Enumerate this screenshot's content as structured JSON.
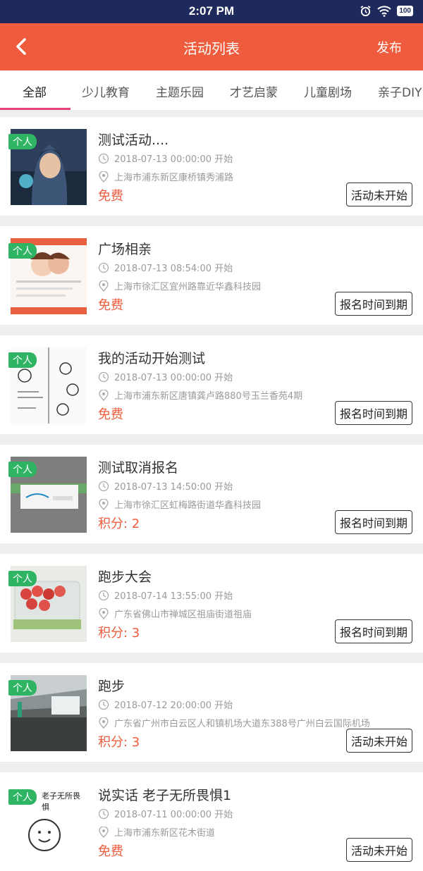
{
  "status_bar": {
    "time": "2:07 PM",
    "battery": "100"
  },
  "header": {
    "title": "活动列表",
    "publish_label": "发布"
  },
  "tabs": [
    {
      "label": "全部"
    },
    {
      "label": "少儿教育"
    },
    {
      "label": "主题乐园"
    },
    {
      "label": "才艺启蒙"
    },
    {
      "label": "儿童剧场"
    },
    {
      "label": "亲子DIY"
    }
  ],
  "activities": [
    {
      "badge": "个人",
      "title": "测试活动....",
      "time": "2018-07-13 00:00:00 开始",
      "location": "上海市浦东新区康桥镇秀浦路",
      "price": "免费",
      "status": "活动未开始"
    },
    {
      "badge": "个人",
      "title": "广场相亲",
      "time": "2018-07-13 08:54:00 开始",
      "location": "上海市徐汇区宜州路靠近华鑫科技园",
      "price": "免费",
      "status": "报名时间到期"
    },
    {
      "badge": "个人",
      "title": "我的活动开始测试",
      "time": "2018-07-13 00:00:00 开始",
      "location": "上海市浦东新区唐镇龚卢路880号玉兰香苑4期",
      "price": "免费",
      "status": "报名时间到期"
    },
    {
      "badge": "个人",
      "title": "测试取消报名",
      "time": "2018-07-13 14:50:00 开始",
      "location": "上海市徐汇区虹梅路街道华鑫科技园",
      "price": "积分: 2",
      "status": "报名时间到期"
    },
    {
      "badge": "个人",
      "title": "跑步大会",
      "time": "2018-07-14 13:55:00 开始",
      "location": "广东省佛山市禅城区祖庙街道祖庙",
      "price": "积分: 3",
      "status": "报名时间到期"
    },
    {
      "badge": "个人",
      "title": "跑步",
      "time": "2018-07-12 20:00:00 开始",
      "location": "广东省广州市白云区人和镇机场大道东388号广州白云国际机场",
      "price": "积分: 3",
      "status": "活动未开始"
    },
    {
      "badge": "个人",
      "title": "说实话 老子无所畏惧1",
      "time": "2018-07-11 00:00:00 开始",
      "location": "上海市浦东新区花木街道",
      "price": "免费",
      "status": "活动未开始",
      "thumb_text": "老子无所畏惧"
    }
  ]
}
